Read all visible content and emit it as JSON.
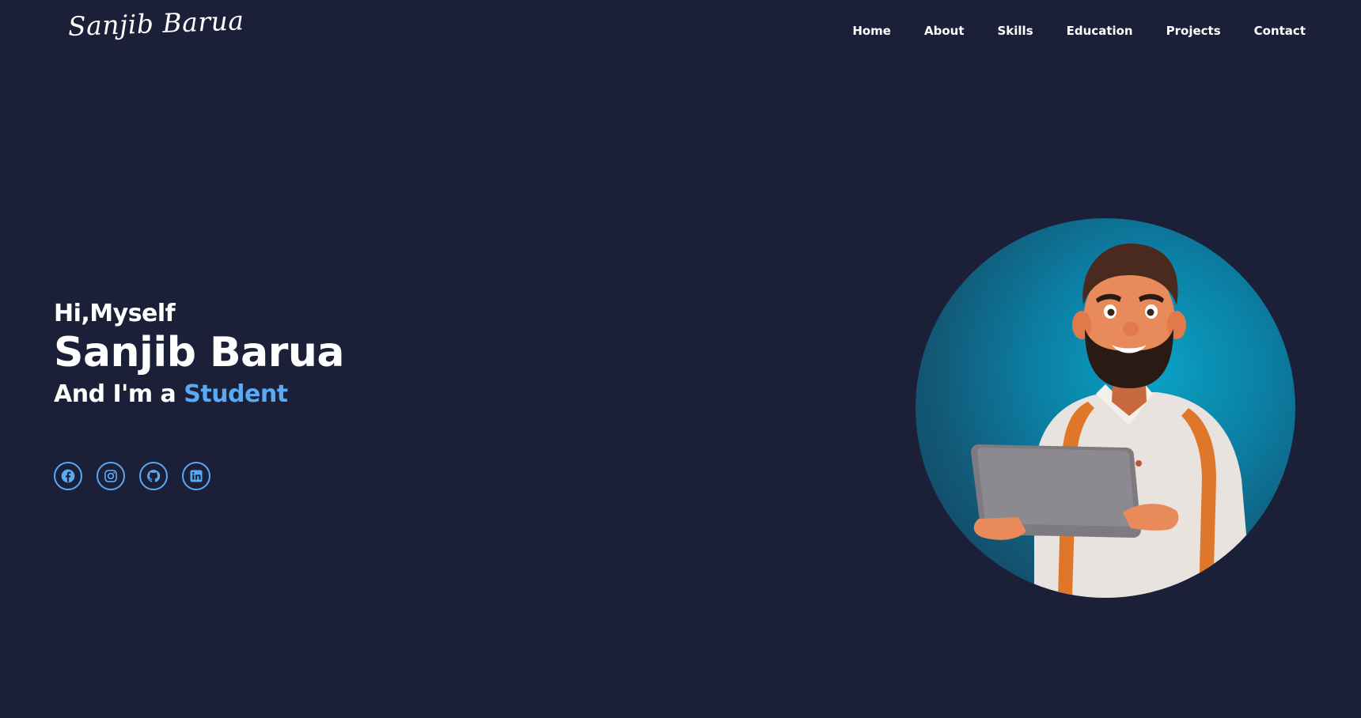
{
  "header": {
    "logo": "Sanjib Barua",
    "nav": [
      "Home",
      "About",
      "Skills",
      "Education",
      "Projects",
      "Contact"
    ]
  },
  "hero": {
    "greeting": "Hi,Myself",
    "name": "Sanjib Barua",
    "role_prefix": "And I'm a",
    "role_accent": "Student"
  },
  "socials": [
    {
      "icon": "facebook-icon"
    },
    {
      "icon": "instagram-icon"
    },
    {
      "icon": "github-icon"
    },
    {
      "icon": "linkedin-icon"
    }
  ],
  "colors": {
    "background": "#1b1f38",
    "accent": "#5aa9f5",
    "text": "#ffffff"
  }
}
